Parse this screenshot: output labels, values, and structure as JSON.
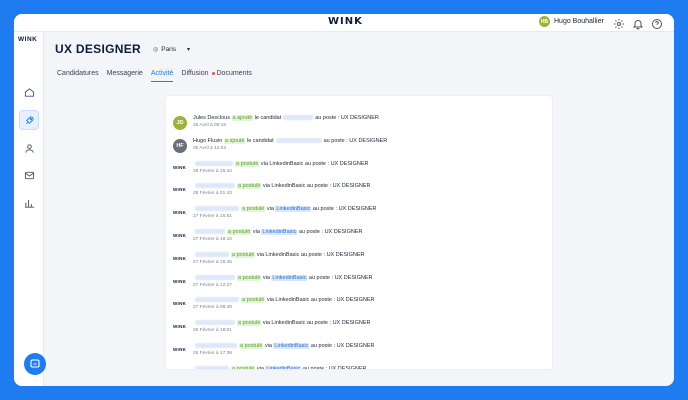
{
  "brand": "WINK",
  "user": {
    "initials": "HB",
    "name": "Hugo Bouhallier"
  },
  "job": {
    "title": "UX DESIGNER",
    "location": "Paris"
  },
  "tabs": [
    {
      "label": "Candidatures",
      "active": false
    },
    {
      "label": "Messagerie",
      "active": false
    },
    {
      "label": "Activité",
      "active": true
    },
    {
      "label": "Diffusion",
      "active": false
    },
    {
      "label": "Documents",
      "active": false
    }
  ],
  "activity": [
    {
      "actor": "Jules Desclous",
      "initials": "JD",
      "action": "a ajouté",
      "mid": "le candidat",
      "channel": "",
      "post": "au poste : UX DESIGNER",
      "date": "25 Avril à 09:15"
    },
    {
      "actor": "Hugo Flusin",
      "initials": "HF",
      "action": "a ajouté",
      "mid": "le candidat",
      "channel": "",
      "post": "au poste : UX DESIGNER",
      "date": "05 Avril à 12:03"
    },
    {
      "actor": "",
      "action": "a postulé",
      "mid": "via",
      "channel": "LinkedinBasic",
      "channel_highlight": false,
      "post": "au poste : UX DESIGNER",
      "date": "28 Février à 15:34"
    },
    {
      "actor": "",
      "action": "a postulé",
      "mid": "via",
      "channel": "LinkedinBasic",
      "channel_highlight": false,
      "post": "au poste : UX DESIGNER",
      "date": "28 Février à 01:43"
    },
    {
      "actor": "",
      "action": "a postulé",
      "mid": "via",
      "channel": "LinkedinBasic",
      "channel_highlight": true,
      "post": "au poste : UX DESIGNER",
      "date": "27 Février à 15:51"
    },
    {
      "actor": "",
      "action": "a postulé",
      "mid": "via",
      "channel": "LinkedinBasic",
      "channel_highlight": true,
      "post": "au poste : UX DESIGNER",
      "date": "27 Février à 18:10"
    },
    {
      "actor": "",
      "action": "a postulé",
      "mid": "via",
      "channel": "LinkedinBasic",
      "channel_highlight": false,
      "post": "au poste : UX DESIGNER",
      "date": "27 Février à 16:45"
    },
    {
      "actor": "",
      "action": "a postulé",
      "mid": "via",
      "channel": "LinkedinBasic",
      "channel_highlight": true,
      "post": "au poste : UX DESIGNER",
      "date": "27 Février à 12:27"
    },
    {
      "actor": "",
      "action": "a postulé",
      "mid": "via",
      "channel": "LinkedinBasic",
      "channel_highlight": false,
      "post": "au poste : UX DESIGNER",
      "date": "27 Février à 08:49"
    },
    {
      "actor": "",
      "action": "a postulé",
      "mid": "via",
      "channel": "LinkedinBasic",
      "channel_highlight": false,
      "post": "au poste : UX DESIGNER",
      "date": "26 Février à 18:01"
    },
    {
      "actor": "",
      "action": "a postulé",
      "mid": "via",
      "channel": "LinkedinBasic",
      "channel_highlight": true,
      "post": "au poste : UX DESIGNER",
      "date": "26 Février à 17:38"
    },
    {
      "actor": "",
      "action": "a postulé",
      "mid": "via",
      "channel": "LinkedinBasic",
      "channel_highlight": true,
      "post": "au poste : UX DESIGNER",
      "date": ""
    }
  ],
  "colors": {
    "accent": "#1f7cf0",
    "green": "#5aa12d",
    "notif": "#e55a3c"
  }
}
